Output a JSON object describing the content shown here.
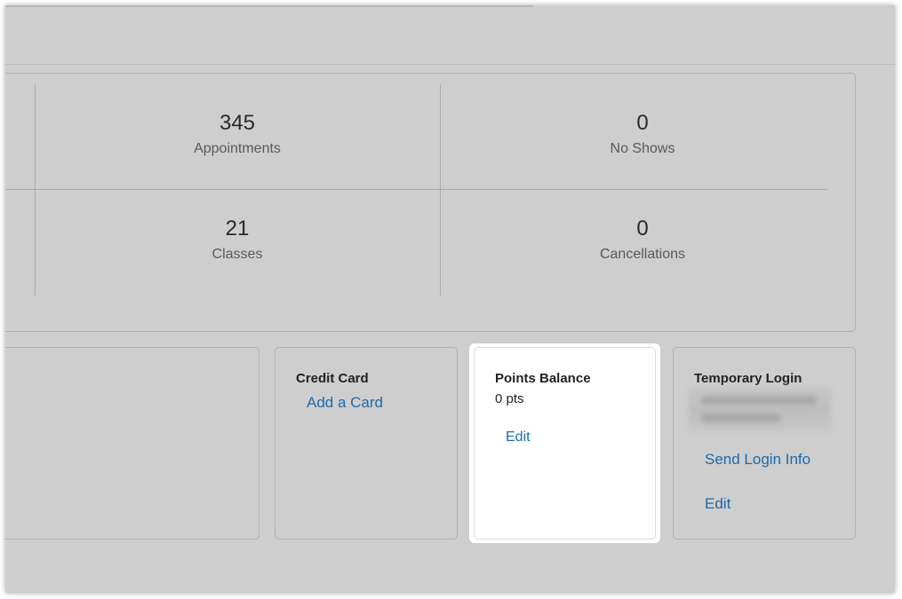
{
  "stats": {
    "appointments": {
      "value": "345",
      "label": "Appointments"
    },
    "no_shows": {
      "value": "0",
      "label": "No Shows"
    },
    "classes": {
      "value": "21",
      "label": "Classes"
    },
    "cancellations": {
      "value": "0",
      "label": "Cancellations"
    }
  },
  "cards": {
    "credit_card": {
      "title": "Credit Card",
      "link": "Add a Card"
    },
    "points_balance": {
      "title": "Points Balance",
      "value": "0 pts",
      "edit": "Edit"
    },
    "temporary_login": {
      "title": "Temporary Login",
      "send": "Send Login Info",
      "edit": "Edit"
    }
  },
  "colors": {
    "link": "#1f6aa8",
    "overlay": "#cecece",
    "highlight": "#ffffff"
  }
}
